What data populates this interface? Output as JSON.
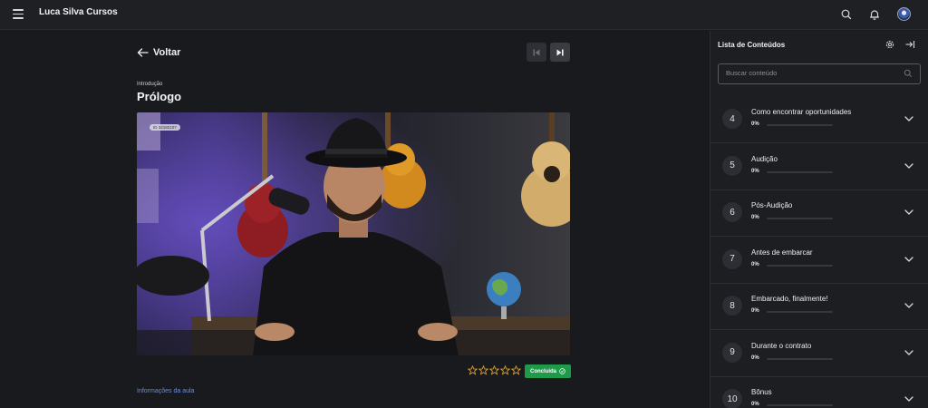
{
  "app": {
    "brand": "Luca Silva Cursos"
  },
  "topbar_icons": {
    "menu": "hamburger-icon",
    "search": "search-icon",
    "notifications": "bell-icon",
    "avatar": "user-avatar"
  },
  "main": {
    "back_label": "Voltar",
    "section": "Introdução",
    "lesson_title": "Prólogo",
    "video_badge": "ID 32182107",
    "rating": {
      "value": 0,
      "max": 5
    },
    "done_label": "Concluída",
    "info_link": "Informações da aula"
  },
  "sidebar": {
    "title": "Lista de Conteúdos",
    "search_placeholder": "Buscar conteúdo",
    "modules": [
      {
        "number": "4",
        "title": "Como encontrar oportunidades",
        "progress_label": "0%",
        "progress": 0
      },
      {
        "number": "5",
        "title": "Audição",
        "progress_label": "0%",
        "progress": 0
      },
      {
        "number": "6",
        "title": "Pós-Audição",
        "progress_label": "0%",
        "progress": 0
      },
      {
        "number": "7",
        "title": "Antes de embarcar",
        "progress_label": "0%",
        "progress": 0
      },
      {
        "number": "8",
        "title": "Embarcado, finalmente!",
        "progress_label": "0%",
        "progress": 0
      },
      {
        "number": "9",
        "title": "Durante o contrato",
        "progress_label": "0%",
        "progress": 0
      },
      {
        "number": "10",
        "title": "Bônus",
        "progress_label": "0%",
        "progress": 0
      }
    ]
  },
  "colors": {
    "accent_green": "#1f9a48",
    "link_blue": "#6c8fd6",
    "star_gold": "#e0a93a",
    "background": "#181a1d"
  }
}
